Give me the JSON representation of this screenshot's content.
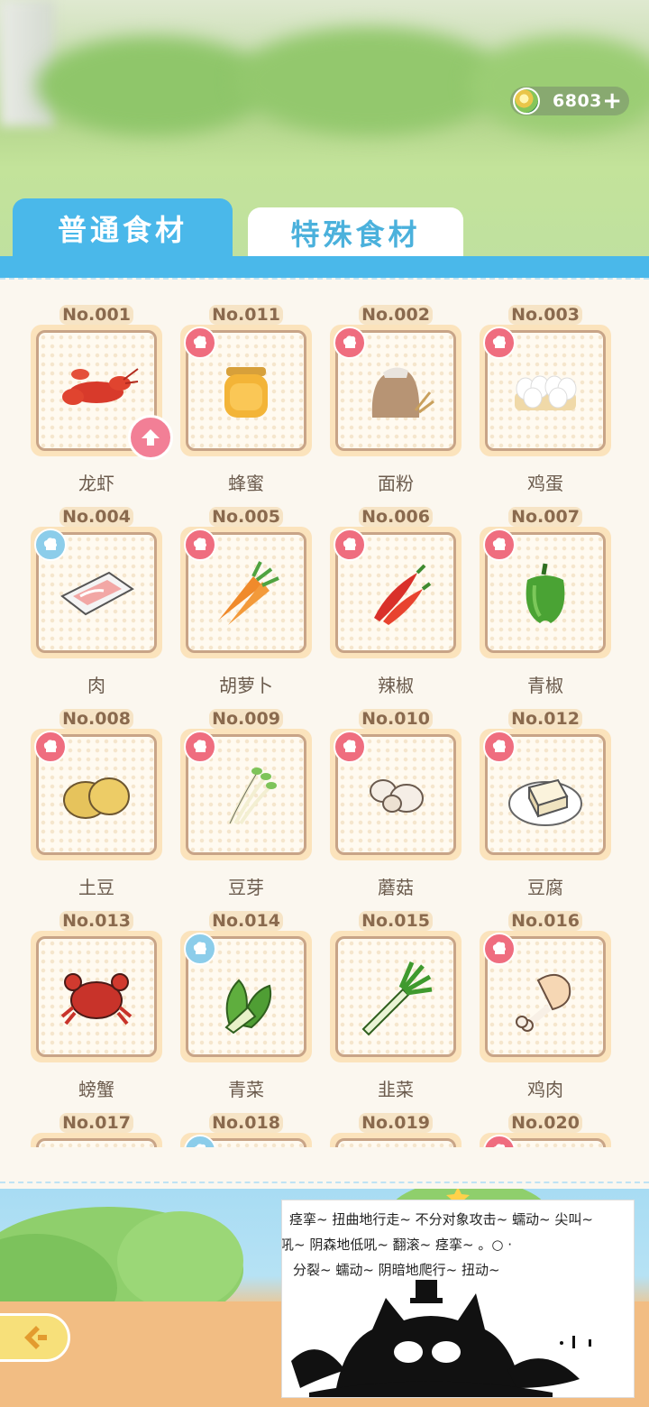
{
  "currency": {
    "amount": "6803",
    "plus_icon": "plus-icon"
  },
  "tabs": [
    {
      "label": "普通食材",
      "active": true
    },
    {
      "label": "特殊食材",
      "active": false
    }
  ],
  "ingredients": [
    {
      "no": "No.001",
      "name": "龙虾",
      "badge": "upgrade",
      "icon": "lobster"
    },
    {
      "no": "No.011",
      "name": "蜂蜜",
      "badge": "pink",
      "icon": "honey"
    },
    {
      "no": "No.002",
      "name": "面粉",
      "badge": "pink",
      "icon": "flour"
    },
    {
      "no": "No.003",
      "name": "鸡蛋",
      "badge": "pink",
      "icon": "eggs"
    },
    {
      "no": "No.004",
      "name": "肉",
      "badge": "blue",
      "icon": "meat"
    },
    {
      "no": "No.005",
      "name": "胡萝卜",
      "badge": "pink",
      "icon": "carrot"
    },
    {
      "no": "No.006",
      "name": "辣椒",
      "badge": "pink",
      "icon": "chili"
    },
    {
      "no": "No.007",
      "name": "青椒",
      "badge": "pink",
      "icon": "pepper"
    },
    {
      "no": "No.008",
      "name": "土豆",
      "badge": "pink",
      "icon": "potato"
    },
    {
      "no": "No.009",
      "name": "豆芽",
      "badge": "pink",
      "icon": "sprout"
    },
    {
      "no": "No.010",
      "name": "蘑菇",
      "badge": "pink",
      "icon": "mushroom"
    },
    {
      "no": "No.012",
      "name": "豆腐",
      "badge": "pink",
      "icon": "tofu"
    },
    {
      "no": "No.013",
      "name": "螃蟹",
      "badge": "none",
      "icon": "crab"
    },
    {
      "no": "No.014",
      "name": "青菜",
      "badge": "blue",
      "icon": "greens"
    },
    {
      "no": "No.015",
      "name": "韭菜",
      "badge": "none",
      "icon": "leek"
    },
    {
      "no": "No.016",
      "name": "鸡肉",
      "badge": "pink",
      "icon": "drumstick"
    },
    {
      "no": "No.017",
      "name": "",
      "badge": "none",
      "icon": ""
    },
    {
      "no": "No.018",
      "name": "",
      "badge": "blue",
      "icon": ""
    },
    {
      "no": "No.019",
      "name": "",
      "badge": "none",
      "icon": ""
    },
    {
      "no": "No.020",
      "name": "",
      "badge": "pink",
      "icon": ""
    }
  ],
  "ad": {
    "lines": [
      "痉挛~  扭曲地行走~  不分对象攻击~   蠕动~ 尖叫~",
      "吼~  阴森地低吼~                    翻滚~   痉挛~ 。○ ·",
      "分裂~  蠕动~                       阴暗地爬行~  扭动~"
    ]
  }
}
